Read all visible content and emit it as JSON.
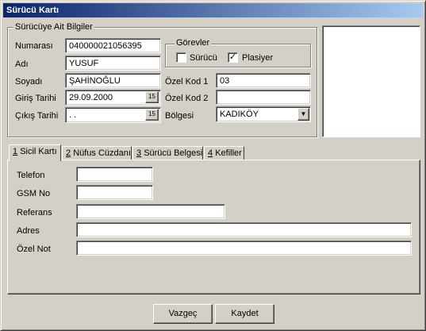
{
  "window": {
    "title": "Sürücü Kartı"
  },
  "driver_group": {
    "legend": "Sürücüye Ait Bilgiler",
    "number_label": "Numarası",
    "number_value": "040000021056395",
    "name_label": "Adı",
    "name_value": "YUSUF",
    "surname_label": "Soyadı",
    "surname_value": "ŞAHİNOĞLU",
    "entry_date_label": "Giriş Tarihi",
    "entry_date_value": "29.09.2000",
    "exit_date_label": "Çıkış Tarihi",
    "exit_date_value": " .  .",
    "date_button_text": "15",
    "roles": {
      "legend": "Görevler",
      "driver_label": "Sürücü",
      "driver_checked": false,
      "plasiyer_label": "Plasiyer",
      "plasiyer_checked": true
    },
    "special_code_1_label": "Özel Kod 1",
    "special_code_1_value": "03",
    "special_code_2_label": "Özel Kod 2",
    "special_code_2_value": "",
    "region_label": "Bölgesi",
    "region_value": "KADIKÖY"
  },
  "tabs": [
    {
      "num": "1",
      "label": "Sicil Kartı"
    },
    {
      "num": "2",
      "label": "Nüfus Cüzdanı"
    },
    {
      "num": "3",
      "label": "Sürücü Belgesi"
    },
    {
      "num": "4",
      "label": "Kefiller"
    }
  ],
  "registry_tab": {
    "phone_label": "Telefon",
    "phone_value": "",
    "gsm_label": "GSM No",
    "gsm_value": "",
    "reference_label": "Referans",
    "reference_value": "",
    "address_label": "Adres",
    "address_value": "",
    "note_label": "Özel Not",
    "note_value": ""
  },
  "buttons": {
    "cancel": "Vazgeç",
    "save": "Kaydet"
  },
  "icons": {
    "calendar": "calendar-icon",
    "dropdown": "chevron-down-icon",
    "check": "check-icon"
  }
}
